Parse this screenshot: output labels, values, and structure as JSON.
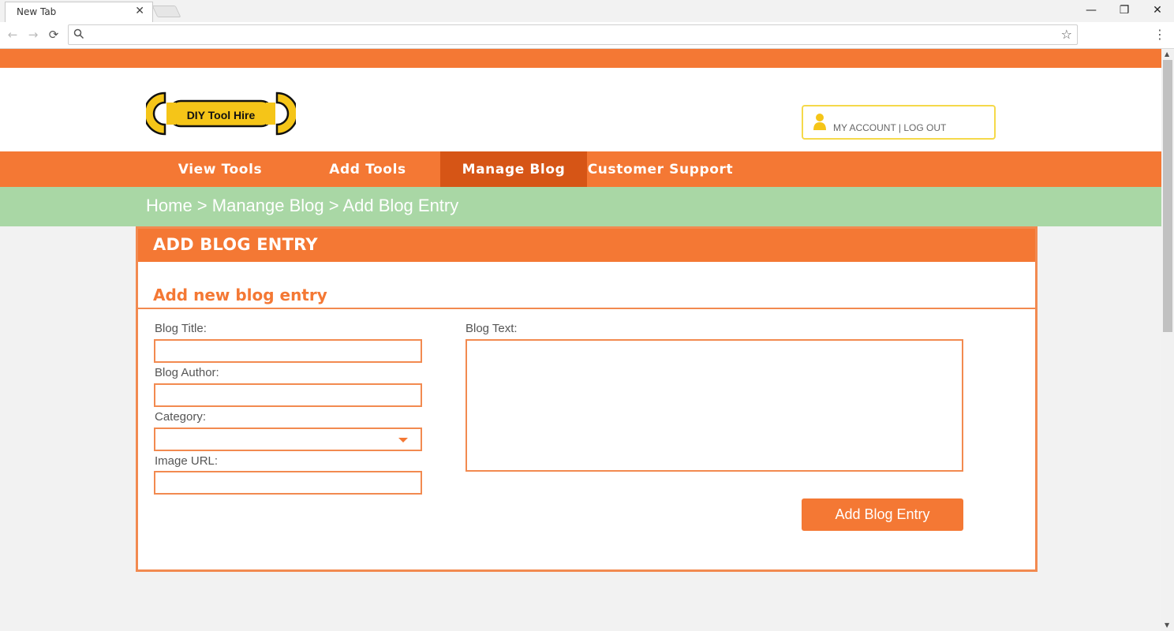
{
  "browser": {
    "tab_title": "New Tab",
    "tab_close": "✕",
    "minimize": "—",
    "restore": "❐",
    "close": "✕",
    "back": "←",
    "forward": "→",
    "reload": "⟳",
    "address": "",
    "star": "☆",
    "menu": "⋮"
  },
  "header": {
    "logo_text": "DIY Tool Hire",
    "account_label": "MY ACCOUNT | LOG OUT"
  },
  "nav": {
    "items": [
      {
        "label": "View Tools"
      },
      {
        "label": "Add Tools"
      },
      {
        "label": "Manage Blog"
      },
      {
        "label": "Customer Support"
      }
    ],
    "active_index": 2
  },
  "breadcrumb": "Home > Manange Blog > Add Blog Entry",
  "panel": {
    "title": "ADD BLOG ENTRY",
    "subtitle": "Add new blog entry",
    "fields": {
      "blog_title_label": "Blog Title:",
      "blog_title_value": "",
      "blog_author_label": "Blog Author:",
      "blog_author_value": "",
      "category_label": "Category:",
      "category_value": "",
      "image_url_label": "Image URL:",
      "image_url_value": "",
      "blog_text_label": "Blog Text:",
      "blog_text_value": ""
    },
    "submit_label": "Add Blog Entry"
  },
  "colors": {
    "orange": "#f47834",
    "orange_dark": "#d65516",
    "green": "#a9d7a5",
    "yellow": "#f5d94a"
  }
}
